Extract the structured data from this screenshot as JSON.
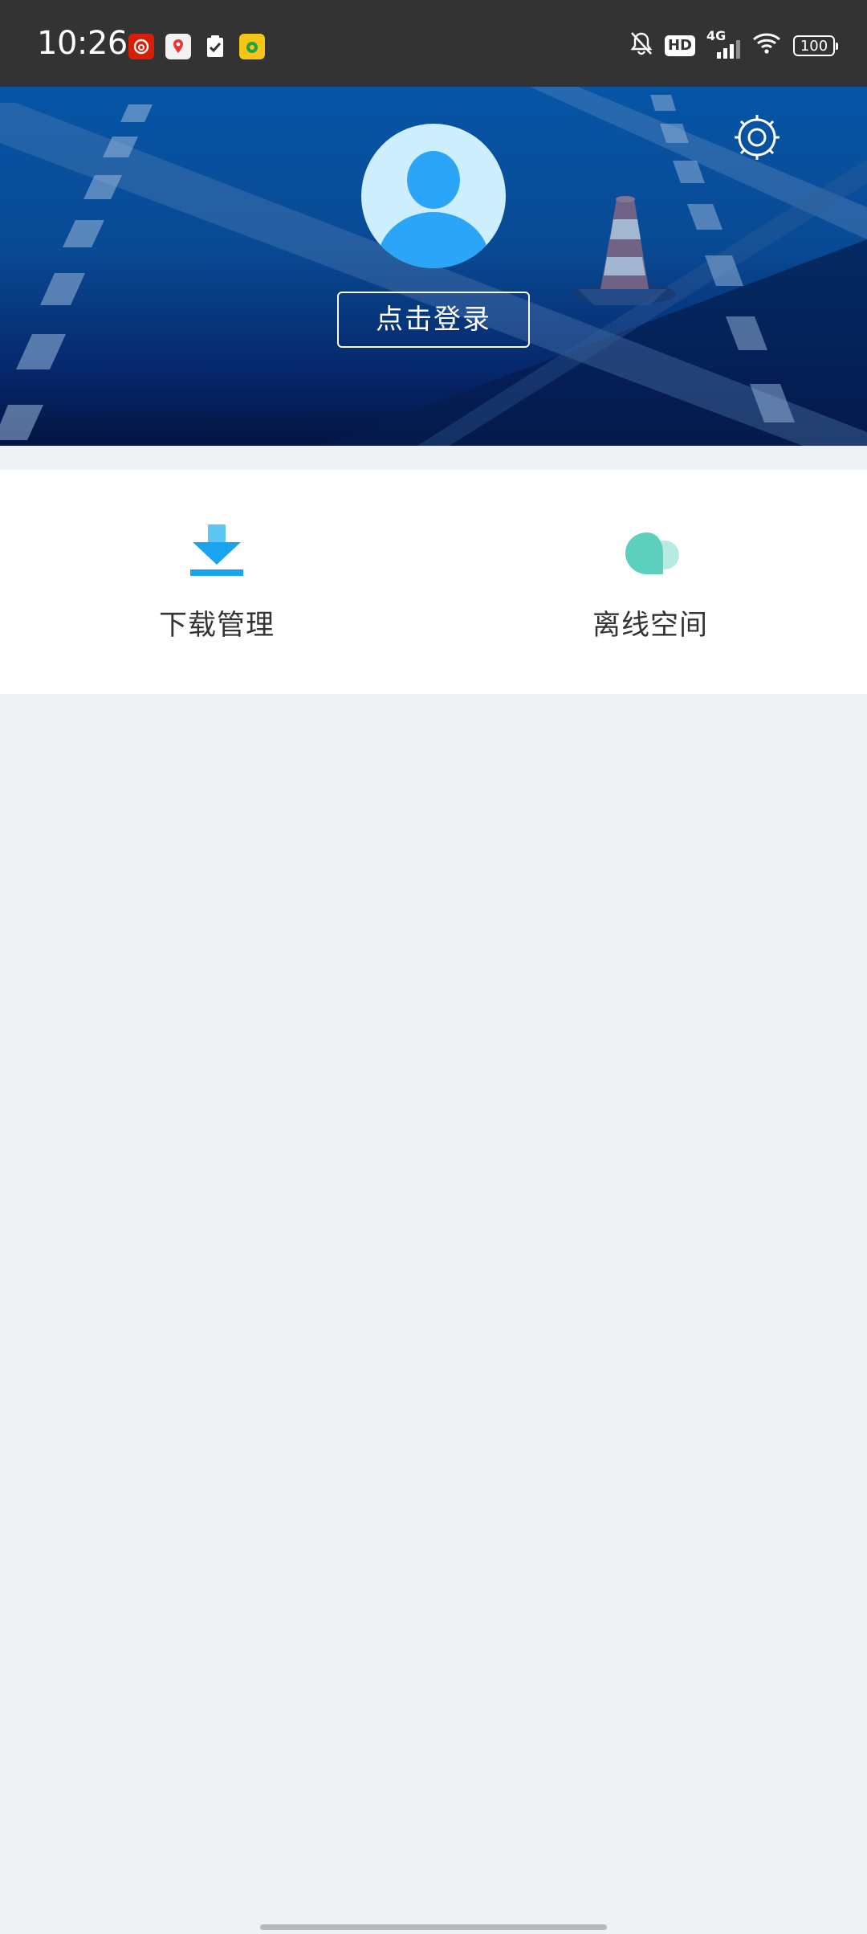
{
  "status_bar": {
    "time": "10:26",
    "hd_label": "HD",
    "network_label": "4G",
    "battery_level": "100"
  },
  "header": {
    "login_label": "点击登录"
  },
  "features": [
    {
      "label": "下载管理",
      "icon": "download-icon"
    },
    {
      "label": "离线空间",
      "icon": "cloud-icon"
    }
  ],
  "colors": {
    "status_bar_bg": "#333333",
    "banner_blue": "#0655a6",
    "avatar_bg": "#cdeefc",
    "avatar_figure": "#2ba5f7",
    "download_icon": "#1aa3ee",
    "cloud_icon": "#5ccfbd",
    "page_bg": "#eef2f5"
  }
}
